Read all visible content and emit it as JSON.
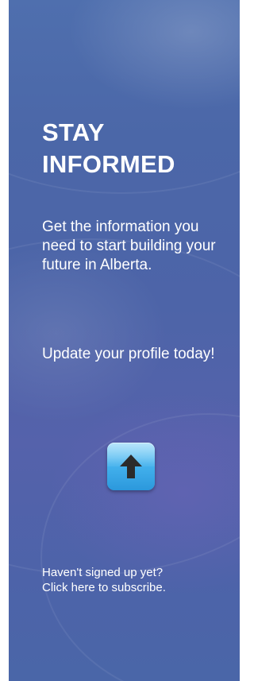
{
  "banner": {
    "title_line1": "STAY",
    "title_line2": "INFORMED",
    "paragraph1": "Get the information you need to start building your future in Alberta.",
    "paragraph2": "Update your profile today!",
    "button_icon": "up-arrow-icon",
    "subscribe_line1": "Haven't signed up yet?",
    "subscribe_line2": "Click here to subscribe.",
    "colors": {
      "background": "#4d66a9",
      "text": "#ffffff",
      "button": "#45b3ee",
      "arrow": "#2b2b2b"
    }
  }
}
